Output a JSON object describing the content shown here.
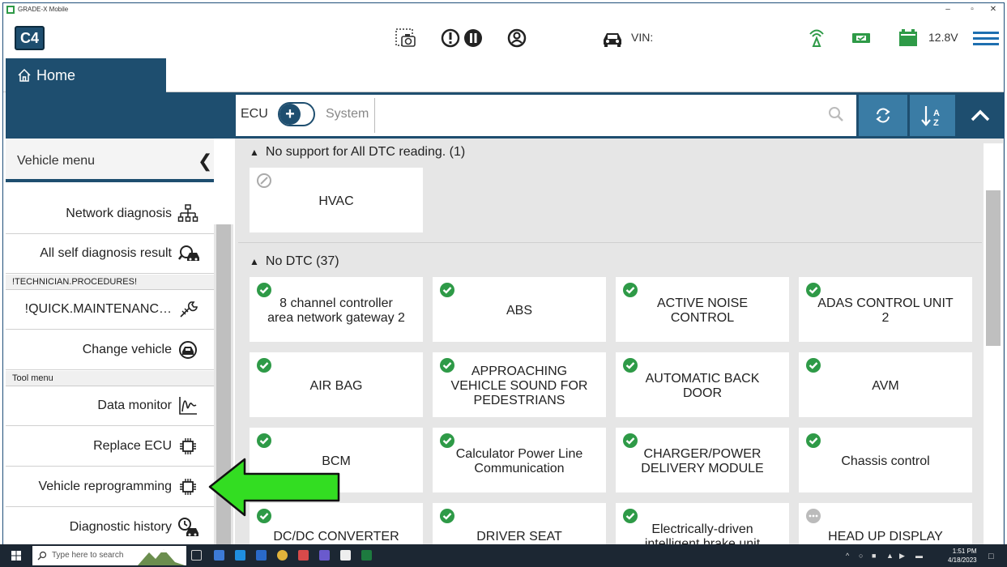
{
  "window": {
    "title": "GRADE-X Mobile",
    "minimize": "–",
    "maximize": "▫",
    "close": "✕"
  },
  "header": {
    "logo": "C4",
    "vin_label": "VIN:",
    "voltage": "12.8V"
  },
  "nav": {
    "home_label": "Home"
  },
  "toolbar": {
    "ecu_label": "ECU",
    "system_label": "System",
    "search_value": "",
    "search_placeholder": ""
  },
  "sidebar": {
    "header": "Vehicle menu",
    "items": [
      {
        "label": "Network diagnosis",
        "icon": "network-icon"
      },
      {
        "label": "All self diagnosis result",
        "icon": "car-search-icon"
      }
    ],
    "section_technician": "!TECHNICIAN.PROCEDURES!",
    "technician_items": [
      {
        "label": "!QUICK.MAINTENANC…",
        "icon": "wrench-icon"
      },
      {
        "label": "Change vehicle",
        "icon": "car-swap-icon"
      }
    ],
    "section_tool": "Tool menu",
    "tool_items": [
      {
        "label": "Data monitor",
        "icon": "waveform-icon"
      },
      {
        "label": "Replace ECU",
        "icon": "chip-icon"
      },
      {
        "label": "Vehicle reprogramming",
        "icon": "chip-icon"
      },
      {
        "label": "Diagnostic history",
        "icon": "history-icon"
      }
    ]
  },
  "groups": [
    {
      "title": "No support for All DTC reading. (1)",
      "ecus": [
        {
          "name": "HVAC",
          "status": "unsupported"
        }
      ]
    },
    {
      "title": "No DTC (37)",
      "ecus": [
        {
          "name": "8 channel controller area network gateway 2",
          "status": "ok"
        },
        {
          "name": "ABS",
          "status": "ok"
        },
        {
          "name": "ACTIVE NOISE CONTROL",
          "status": "ok"
        },
        {
          "name": "ADAS CONTROL UNIT 2",
          "status": "ok"
        },
        {
          "name": "AIR BAG",
          "status": "ok"
        },
        {
          "name": "APPROACHING VEHICLE SOUND FOR PEDESTRIANS",
          "status": "ok"
        },
        {
          "name": "AUTOMATIC BACK DOOR",
          "status": "ok"
        },
        {
          "name": "AVM",
          "status": "ok"
        },
        {
          "name": "BCM",
          "status": "ok"
        },
        {
          "name": "Calculator Power Line Communication",
          "status": "ok"
        },
        {
          "name": "CHARGER/POWER DELIVERY MODULE",
          "status": "ok"
        },
        {
          "name": "Chassis control",
          "status": "ok"
        },
        {
          "name": "DC/DC CONVERTER",
          "status": "ok"
        },
        {
          "name": "DRIVER SEAT",
          "status": "ok"
        },
        {
          "name": "Electrically-driven intelligent brake unit",
          "status": "ok"
        },
        {
          "name": "HEAD UP DISPLAY",
          "status": "pending"
        }
      ]
    }
  ],
  "taskbar": {
    "search_placeholder": "Type here to search",
    "time": "1:51 PM",
    "date": "4/18/2023"
  },
  "colors": {
    "brand": "#1e4e6f",
    "accent": "#3a7ca5",
    "ok": "#2e9a47",
    "arrow": "#33dd22"
  }
}
